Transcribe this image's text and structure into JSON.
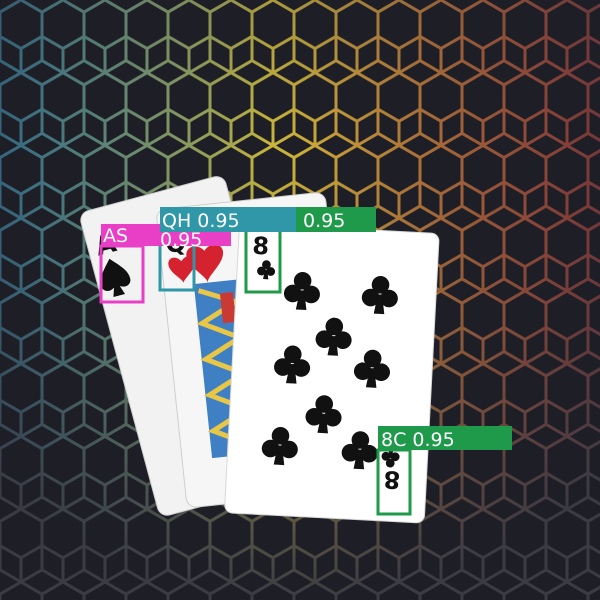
{
  "colors": {
    "background_base": "#1e1f26",
    "hex_glow_left": "#2fa9d8",
    "hex_glow_middle": "#e8d23a",
    "hex_glow_right": "#d8342a",
    "box_as": "#e83fc6",
    "box_qh": "#2f97a8",
    "box_8c": "#1f9a4a"
  },
  "cards": [
    {
      "id": "AS",
      "rank": "A",
      "suit": "spade-icon"
    },
    {
      "id": "QH",
      "rank": "Q",
      "suit": "heart-icon"
    },
    {
      "id": "8C",
      "rank": "8",
      "suit": "club-icon"
    }
  ],
  "detections": [
    {
      "class": "AS",
      "confidence": "0.95",
      "caption": "AS"
    },
    {
      "class": "QH",
      "confidence": "0.95",
      "caption": "QH 0.95"
    },
    {
      "class": "8C",
      "confidence": "0.95",
      "caption": "0.95"
    },
    {
      "class": "8C",
      "confidence": "0.95",
      "caption": "8C 0.95"
    }
  ],
  "occluded_caption_fragment": "0.95"
}
